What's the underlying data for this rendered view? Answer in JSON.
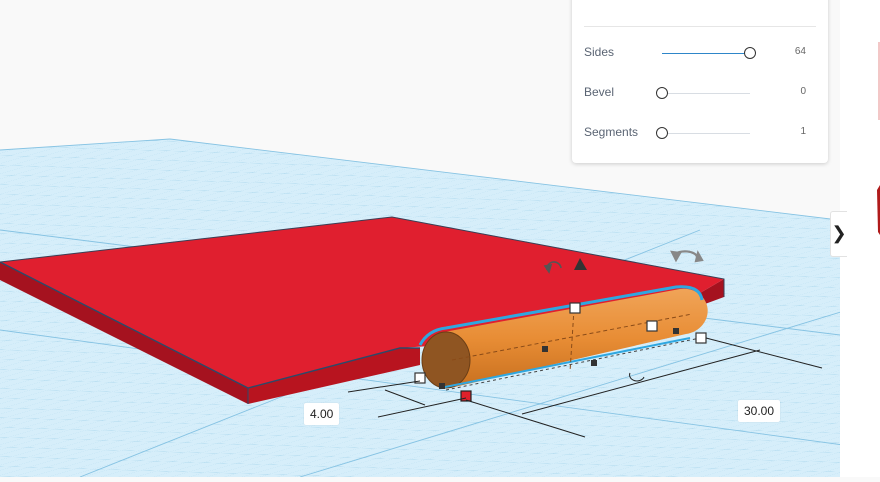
{
  "properties": {
    "sides": {
      "label": "Sides",
      "value": "64",
      "level": 1.0
    },
    "bevel": {
      "label": "Bevel",
      "value": "0",
      "level": 0.0
    },
    "segments": {
      "label": "Segments",
      "value": "1",
      "level": 0.0
    }
  },
  "dimensions": {
    "width": "4.00",
    "length": "30.00"
  },
  "panel_toggle": {
    "glyph": "❯"
  },
  "colors": {
    "workplane": "#d6eefa",
    "grid_minor": "#aed8ee",
    "grid_major": "#7fbfe0",
    "box_top": "#e01f2f",
    "box_side": "#a5121f",
    "cylinder": "#e8913c",
    "selection": "#2fa7e0",
    "slider_fill": "#2e86c9"
  }
}
